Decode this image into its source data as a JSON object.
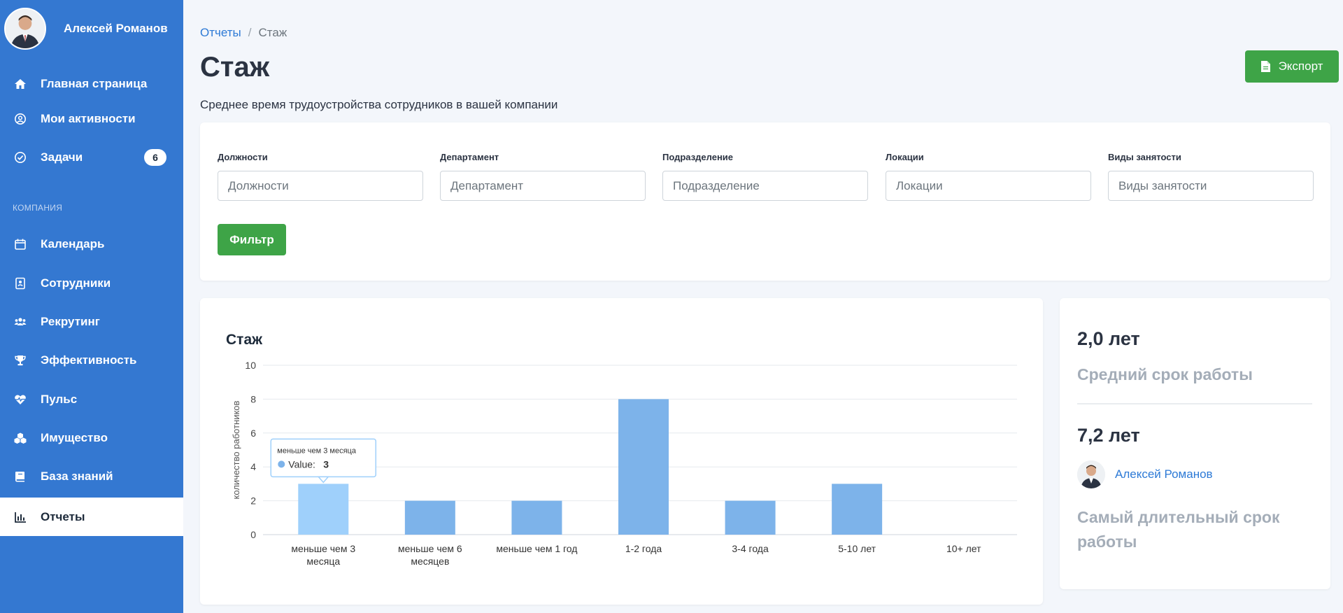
{
  "user": {
    "name": "Алексей Романов"
  },
  "nav": {
    "items": [
      {
        "label": "Главная страница",
        "icon": "home-icon"
      },
      {
        "label": "Мои активности",
        "icon": "user-circle-icon"
      },
      {
        "label": "Задачи",
        "icon": "check-circle-icon",
        "badge": "6"
      }
    ],
    "section_label": "КОМПАНИЯ",
    "company_items": [
      {
        "label": "Календарь",
        "icon": "calendar-icon"
      },
      {
        "label": "Сотрудники",
        "icon": "id-card-icon"
      },
      {
        "label": "Рекрутинг",
        "icon": "users-icon"
      },
      {
        "label": "Эффективность",
        "icon": "trophy-icon"
      },
      {
        "label": "Пульс",
        "icon": "heartbeat-icon"
      },
      {
        "label": "Имущество",
        "icon": "cubes-icon"
      },
      {
        "label": "База знаний",
        "icon": "book-icon"
      },
      {
        "label": "Отчеты",
        "icon": "chart-icon",
        "active": true
      }
    ]
  },
  "breadcrumb": {
    "parent": "Отчеты",
    "separator": "/",
    "current": "Стаж"
  },
  "page": {
    "title": "Стаж",
    "subtitle": "Среднее время трудоустройства сотрудников в вашей компании",
    "export_label": "Экспорт"
  },
  "filters": {
    "fields": [
      {
        "label": "Должности",
        "placeholder": "Должности"
      },
      {
        "label": "Департамент",
        "placeholder": "Департамент"
      },
      {
        "label": "Подразделение",
        "placeholder": "Подразделение"
      },
      {
        "label": "Локации",
        "placeholder": "Локации"
      },
      {
        "label": "Виды занятости",
        "placeholder": "Виды занятости"
      }
    ],
    "button_label": "Фильтр"
  },
  "chart_data": {
    "type": "bar",
    "title": "Стаж",
    "ylabel": "количество работников",
    "xlabel": "",
    "categories": [
      "меньше чем 3 месяца",
      "меньше чем 6 месяцев",
      "меньше чем 1 год",
      "1-2 года",
      "3-4 года",
      "5-10 лет",
      "10+ лет"
    ],
    "category_lines": [
      [
        "меньше чем 3",
        "месяца"
      ],
      [
        "меньше чем 6",
        "месяцев"
      ],
      [
        "меньше чем 1 год"
      ],
      [
        "1-2 года"
      ],
      [
        "3-4 года"
      ],
      [
        "5-10 лет"
      ],
      [
        "10+ лет"
      ]
    ],
    "values": [
      3,
      2,
      2,
      8,
      2,
      3,
      0
    ],
    "ylim": [
      0,
      10
    ],
    "yticks": [
      0,
      2,
      4,
      6,
      8,
      10
    ],
    "grid": true,
    "bar_color": "#7db3ea",
    "highlight_color": "#9fd0fb",
    "tooltip": {
      "index": 0,
      "title": "меньше чем 3 месяца",
      "label": "Value:",
      "value": "3"
    }
  },
  "stats": {
    "avg_value": "2,0 лет",
    "avg_label": "Средний срок работы",
    "max_value": "7,2 лет",
    "max_user": "Алексей Романов",
    "max_label_line1": "Самый длительный срок",
    "max_label_line2": "работы"
  },
  "colors": {
    "sidebar": "#3478d1",
    "accent_green": "#3ea447",
    "link": "#2d7ad6"
  }
}
